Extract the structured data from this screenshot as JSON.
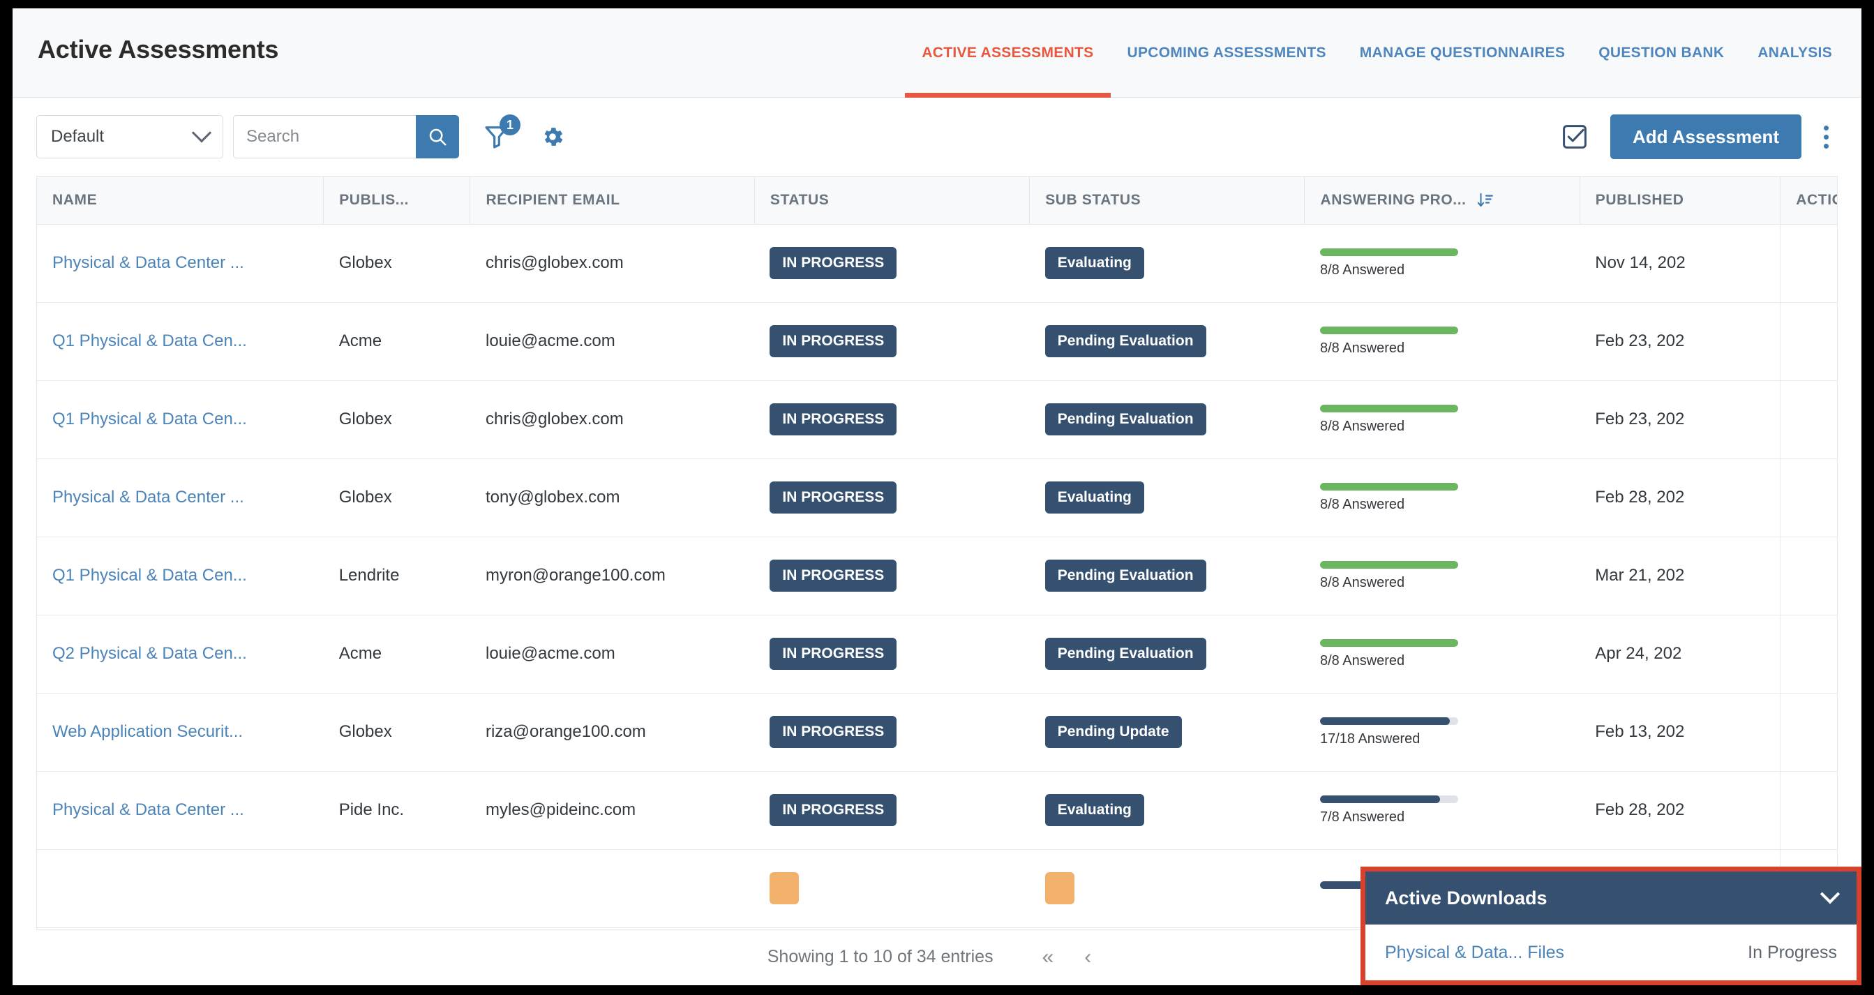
{
  "header": {
    "title": "Active Assessments",
    "tabs": [
      {
        "label": "ACTIVE ASSESSMENTS",
        "active": true
      },
      {
        "label": "UPCOMING ASSESSMENTS",
        "active": false
      },
      {
        "label": "MANAGE QUESTIONNAIRES",
        "active": false
      },
      {
        "label": "QUESTION BANK",
        "active": false
      },
      {
        "label": "ANALYSIS",
        "active": false
      }
    ]
  },
  "toolbar": {
    "view_select_value": "Default",
    "search_placeholder": "Search",
    "search_value": "",
    "filter_badge_count": "1",
    "add_label": "Add Assessment"
  },
  "table": {
    "columns": [
      {
        "key": "name",
        "label": "NAME"
      },
      {
        "key": "publisher",
        "label": "PUBLIS..."
      },
      {
        "key": "email",
        "label": "RECIPIENT EMAIL"
      },
      {
        "key": "status",
        "label": "STATUS"
      },
      {
        "key": "substatus",
        "label": "SUB STATUS"
      },
      {
        "key": "progress",
        "label": "ANSWERING PRO...",
        "sorted": "desc"
      },
      {
        "key": "published",
        "label": "PUBLISHED"
      },
      {
        "key": "actions",
        "label": "ACTIONS"
      }
    ],
    "rows": [
      {
        "name": "Physical & Data Center ...",
        "publisher": "Globex",
        "email": "chris@globex.com",
        "status": "IN PROGRESS",
        "substatus": "Evaluating",
        "progress_label": "8/8 Answered",
        "progress_pct": 100,
        "progress_color": "#6cb561",
        "published": "Nov 14, 202"
      },
      {
        "name": "Q1 Physical & Data Cen...",
        "publisher": "Acme",
        "email": "louie@acme.com",
        "status": "IN PROGRESS",
        "substatus": "Pending Evaluation",
        "progress_label": "8/8 Answered",
        "progress_pct": 100,
        "progress_color": "#6cb561",
        "published": "Feb 23, 202"
      },
      {
        "name": "Q1 Physical & Data Cen...",
        "publisher": "Globex",
        "email": "chris@globex.com",
        "status": "IN PROGRESS",
        "substatus": "Pending Evaluation",
        "progress_label": "8/8 Answered",
        "progress_pct": 100,
        "progress_color": "#6cb561",
        "published": "Feb 23, 202"
      },
      {
        "name": "Physical & Data Center ...",
        "publisher": "Globex",
        "email": "tony@globex.com",
        "status": "IN PROGRESS",
        "substatus": "Evaluating",
        "progress_label": "8/8 Answered",
        "progress_pct": 100,
        "progress_color": "#6cb561",
        "published": "Feb 28, 202"
      },
      {
        "name": "Q1 Physical & Data Cen...",
        "publisher": "Lendrite",
        "email": "myron@orange100.com",
        "status": "IN PROGRESS",
        "substatus": "Pending Evaluation",
        "progress_label": "8/8 Answered",
        "progress_pct": 100,
        "progress_color": "#6cb561",
        "published": "Mar 21, 202"
      },
      {
        "name": "Q2 Physical & Data Cen...",
        "publisher": "Acme",
        "email": "louie@acme.com",
        "status": "IN PROGRESS",
        "substatus": "Pending Evaluation",
        "progress_label": "8/8 Answered",
        "progress_pct": 100,
        "progress_color": "#6cb561",
        "published": "Apr 24, 202"
      },
      {
        "name": "Web Application Securit...",
        "publisher": "Globex",
        "email": "riza@orange100.com",
        "status": "IN PROGRESS",
        "substatus": "Pending Update",
        "progress_label": "17/18 Answered",
        "progress_pct": 94,
        "progress_color": "#36506f",
        "published": "Feb 13, 202"
      },
      {
        "name": "Physical & Data Center ...",
        "publisher": "Pide Inc.",
        "email": "myles@pideinc.com",
        "status": "IN PROGRESS",
        "substatus": "Evaluating",
        "progress_label": "7/8 Answered",
        "progress_pct": 87,
        "progress_color": "#36506f",
        "published": "Feb 28, 202"
      }
    ]
  },
  "footer": {
    "showing": "Showing 1 to 10 of 34 entries",
    "first_label": "«",
    "prev_label": "‹"
  },
  "downloads": {
    "title": "Active Downloads",
    "items": [
      {
        "file": "Physical & Data... Files",
        "status": "In Progress"
      }
    ]
  },
  "colors": {
    "accent_blue": "#3d7ab0",
    "accent_orange": "#e8573f",
    "badge_navy": "#36506f",
    "progress_green": "#6cb561",
    "highlight_red": "#d8422c"
  }
}
